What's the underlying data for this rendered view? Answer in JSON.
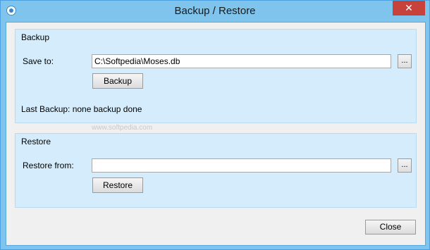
{
  "window": {
    "title": "Backup / Restore",
    "close_glyph": "✕",
    "icon": "app-icon"
  },
  "backup": {
    "group_title": "Backup",
    "save_to_label": "Save to:",
    "save_to_value": "C:\\Softpedia\\Moses.db",
    "browse_label": "...",
    "button_label": "Backup",
    "status_text": "Last Backup: none backup done"
  },
  "watermark": "www.softpedia.com",
  "restore": {
    "group_title": "Restore",
    "restore_from_label": "Restore from:",
    "restore_from_value": "",
    "browse_label": "...",
    "button_label": "Restore"
  },
  "footer": {
    "close_label": "Close"
  }
}
